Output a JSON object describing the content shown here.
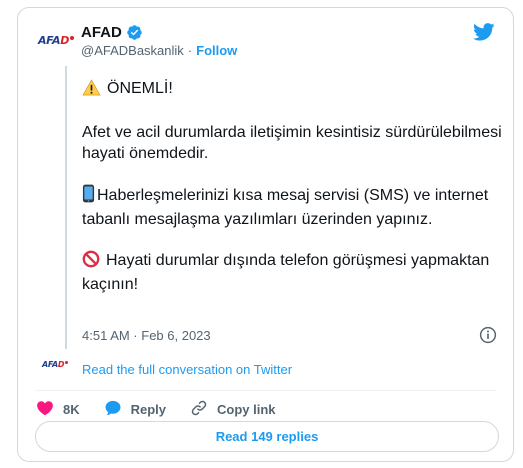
{
  "tweet": {
    "display_name": "AFAD",
    "handle": "@AFADBaskanlik",
    "separator": "·",
    "follow_label": "Follow",
    "logo_text_blue": "AFA",
    "logo_text_red": "D",
    "paragraphs": [
      "ÖNEMLİ!",
      "Afet ve acil durumlarda iletişimin kesintisiz sürdürülebilmesi hayati önemdedir.",
      "Haberleşmelerinizi kısa mesaj servisi (SMS) ve internet tabanlı mesajlaşma yazılımları üzerinden yapınız.",
      "Hayati durumlar dışında telefon görüşmesi yapmaktan kaçının!"
    ],
    "timestamp": "4:51 AM · Feb 6, 2023",
    "conversation_link": "Read the full conversation on Twitter",
    "actions": {
      "like_count": "8K",
      "reply_label": "Reply",
      "copy_label": "Copy link"
    },
    "read_replies_label": "Read 149 replies"
  },
  "icons": {
    "bird": "twitter-bird-icon",
    "verified": "verified-badge-icon",
    "warning": "warning-icon",
    "phone": "mobile-phone-icon",
    "prohibited": "prohibited-icon",
    "info": "info-icon",
    "heart": "heart-icon",
    "reply": "reply-bubble-icon",
    "link": "link-icon"
  },
  "colors": {
    "accent": "#1d9bf0",
    "text": "#0f1419",
    "muted": "#536471",
    "border": "#cfd9de",
    "like": "#f91880",
    "logo_blue": "#1f3f8f",
    "logo_red": "#d8232a"
  }
}
